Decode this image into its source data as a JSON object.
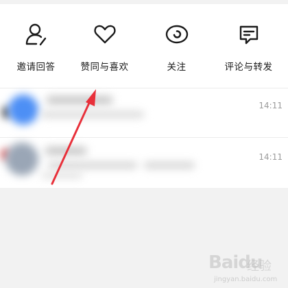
{
  "actions": [
    {
      "label": "邀请回答",
      "icon": "person-edit-icon"
    },
    {
      "label": "赞同与喜欢",
      "icon": "heart-icon"
    },
    {
      "label": "关注",
      "icon": "eye-icon"
    },
    {
      "label": "评论与转发",
      "icon": "comment-icon"
    }
  ],
  "notifications": [
    {
      "time": "14:11"
    },
    {
      "time": "14:11"
    }
  ],
  "watermark": {
    "brand": "Baidu",
    "brand_cn": "经验",
    "url": "jingyan.baidu.com"
  },
  "colors": {
    "arrow": "#e8303a",
    "icon_stroke": "#1a1a1a",
    "time_text": "#9a9a9a"
  }
}
